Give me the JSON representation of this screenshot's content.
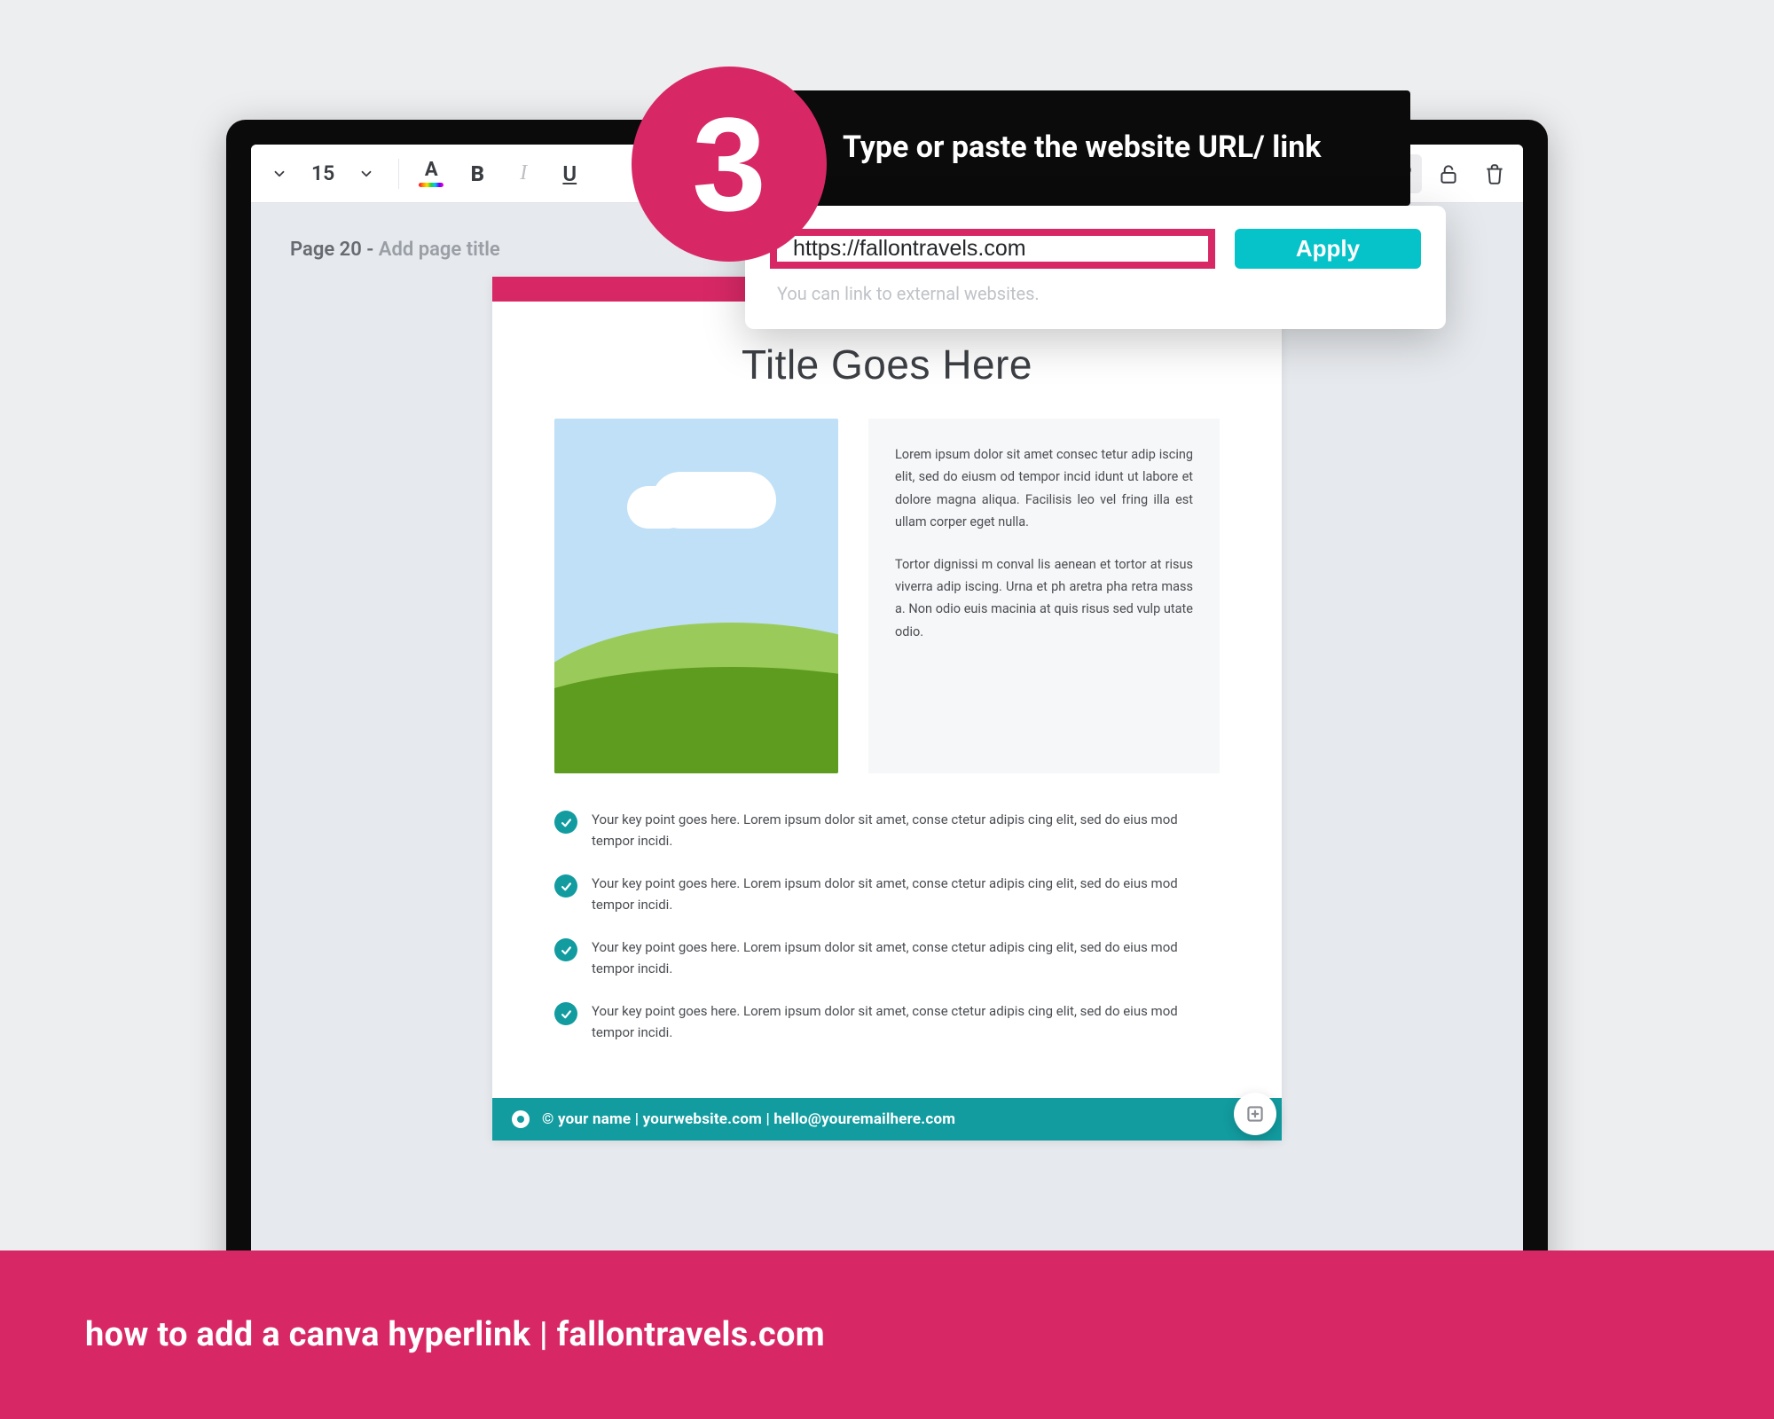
{
  "step": {
    "number": "3",
    "instruction": "Type or paste the website URL/ link"
  },
  "toolbar": {
    "font_size": "15",
    "text_color_label": "A",
    "bold_label": "B",
    "italic_label": "I",
    "underline_label": "U",
    "icons": {
      "font_dropdown": "chevron-down",
      "size_dropdown": "chevron-down",
      "paint_roller": "paint-roller",
      "transparency": "transparency",
      "link": "link",
      "lock": "lock",
      "delete": "trash"
    }
  },
  "page": {
    "label_prefix": "Page 20 - ",
    "label_placeholder": "Add page title"
  },
  "document": {
    "title": "Title Goes Here",
    "paragraph1": "Lorem ipsum dolor sit amet consec tetur adip iscing elit, sed do eiusm od tempor incid idunt ut labore et dolore magna aliqua. Facilisis leo vel fring illa est ullam corper eget nulla.",
    "paragraph2": "Tortor dignissi m conval lis aenean et tortor at risus viverra adip iscing. Urna et ph aretra pha retra mass a. Non odio euis macinia at quis risus sed vulp utate odio.",
    "bullets": [
      "Your key point goes here. Lorem ipsum dolor sit amet, conse ctetur adipis cing elit, sed do eius mod tempor incidi.",
      "Your key point goes here. Lorem ipsum dolor sit amet, conse ctetur adipis cing elit, sed do eius mod tempor incidi.",
      "Your key point goes here. Lorem ipsum dolor sit amet, conse ctetur adipis cing elit, sed do eius mod tempor incidi.",
      "Your key point goes here. Lorem ipsum dolor sit amet, conse ctetur adipis cing elit, sed do eius mod tempor incidi."
    ],
    "footer": "© your name | yourwebsite.com | hello@youremailhere.com"
  },
  "link_popover": {
    "url": "https://fallontravels.com",
    "apply_label": "Apply",
    "hint": "You can link to external websites."
  },
  "banner": {
    "text": "how to add a canva hyperlink | fallontravels.com"
  },
  "colors": {
    "accent_pink": "#d72865",
    "accent_teal": "#06c3c9",
    "doc_teal": "#129ca0"
  }
}
